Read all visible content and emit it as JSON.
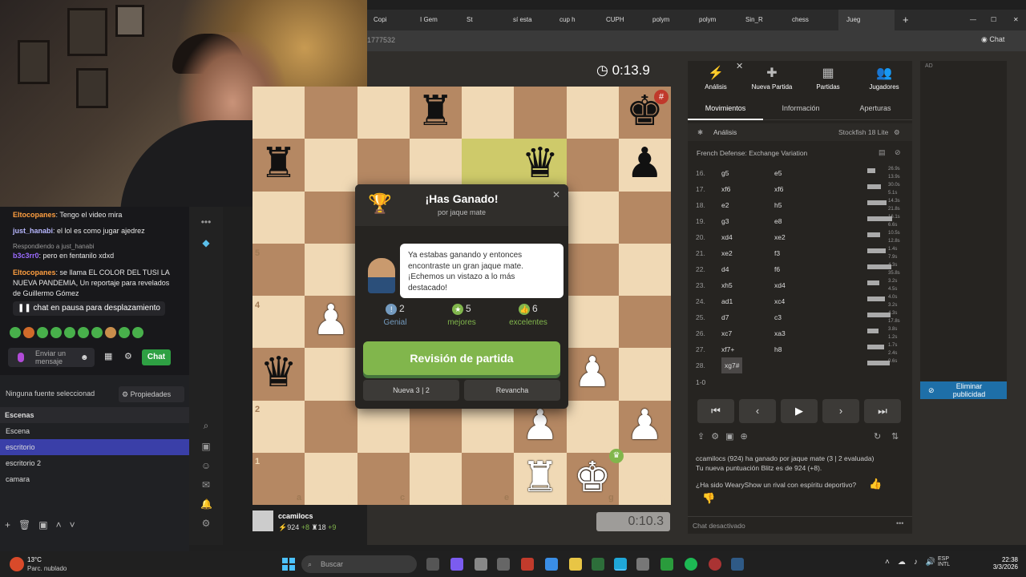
{
  "browser": {
    "tabs": [
      "Copi",
      "I Gem",
      "St",
      "sí esta",
      "cup h",
      "CUPH",
      "polym",
      "polym",
      "Sin_R",
      "chess",
      "Jueg"
    ],
    "url": "1777532"
  },
  "game": {
    "top_clock": "0:13.9",
    "bottom_clock": "0:10.3",
    "ranks": [
      "5",
      "4",
      "3",
      "2",
      "1"
    ],
    "files": [
      "a",
      "b",
      "c",
      "d",
      "e",
      "f",
      "g",
      "h"
    ],
    "player": {
      "name": "ccamilocs",
      "rating": "924",
      "rating_delta": "+8",
      "puzzles": "18",
      "puzzles_delta": "+9"
    }
  },
  "modal": {
    "title": "¡Has Ganado!",
    "subtitle": "por jaque mate",
    "message": "Ya estabas ganando y entonces encontraste un gran jaque mate. ¡Echemos un vistazo a lo más destacado!",
    "stats": [
      {
        "count": "2",
        "label": "Genial",
        "color": "#749bbf"
      },
      {
        "count": "5",
        "label": "mejores",
        "color": "#81b64c"
      },
      {
        "count": "6",
        "label": "excelentes",
        "color": "#81b64c"
      }
    ],
    "review_button": "Revisión de partida",
    "new_game_button": "Nueva 3 | 2",
    "rematch_button": "Revancha"
  },
  "panel": {
    "top_tabs": [
      "Análisis",
      "Nueva Partida",
      "Partidas",
      "Jugadores"
    ],
    "sub_tabs": [
      "Movimientos",
      "Información",
      "Aperturas"
    ],
    "analysis_label": "Análisis",
    "engine": "Stockfish 18 Lite",
    "opening": "French Defense: Exchange Variation",
    "moves": [
      {
        "n": "16.",
        "w": "g5",
        "b": "e5",
        "e1": "26.9s",
        "e2": "13.9s"
      },
      {
        "n": "17.",
        "w": "xf6",
        "b": "xf6",
        "e1": "30.0s",
        "e2": "5.1s"
      },
      {
        "n": "18.",
        "w": "e2",
        "b": "h5",
        "e1": "14.3s",
        "e2": "21.8s"
      },
      {
        "n": "19.",
        "w": "g3",
        "b": "e8",
        "e1": "16.1s",
        "e2": "6.6s"
      },
      {
        "n": "20.",
        "w": "xd4",
        "b": "xe2",
        "e1": "10.5s",
        "e2": "12.8s"
      },
      {
        "n": "21.",
        "w": "xe2",
        "b": "f3",
        "e1": "1.4s",
        "e2": "7.9s"
      },
      {
        "n": "22.",
        "w": "d4",
        "b": "f6",
        "e1": "4.3s",
        "e2": "35.8s"
      },
      {
        "n": "23.",
        "w": "xh5",
        "b": "xd4",
        "e1": "3.2s",
        "e2": "4.5s"
      },
      {
        "n": "24.",
        "w": "ad1",
        "b": "xc4",
        "e1": "4.0s",
        "e2": "3.2s"
      },
      {
        "n": "25.",
        "w": "d7",
        "b": "c3",
        "e1": "4.3s",
        "e2": "17.8s"
      },
      {
        "n": "26.",
        "w": "xc7",
        "b": "xa3",
        "e1": "3.8s",
        "e2": "1.2s"
      },
      {
        "n": "27.",
        "w": "xf7+",
        "b": "h8",
        "e1": "1.7s",
        "e2": "2.4s"
      },
      {
        "n": "28.",
        "w": "xg7#",
        "b": "",
        "e1": "0.6s",
        "e2": ""
      }
    ],
    "result": "1-0",
    "summary_line1": "ccamilocs (924) ha ganado por jaque mate (3 | 2 evaluada)",
    "summary_line2": "Tu nueva puntuación Blitz es de 924 (+8).",
    "sportsmanship": "¿Ha sido WearyShow un rival con espíritu deportivo?",
    "chat_status": "Chat desactivado"
  },
  "ad": {
    "label": "AD",
    "remove_button": "Eliminar publicidad"
  },
  "stream_chat": {
    "messages": [
      {
        "user": "Eltocopanes",
        "text": "Tengo el video mira"
      },
      {
        "user": "just_hanabi",
        "text": "el lol es como jugar ajedrez"
      },
      {
        "user": "b3c3rr0",
        "text": "pero en fentanilo xdxd"
      },
      {
        "user": "Eltocopanes",
        "text": "se llama EL COLOR DEL TUSI LA NUEVA PANDEMIA, Un reportaje para revelados de Guillermo Gómez"
      }
    ],
    "replying": "Respondiendo a just_hanabi",
    "paused": "chat en pausa para desplazamiento",
    "input_placeholder": "Enviar un mensaje",
    "chat_button": "Chat"
  },
  "obs": {
    "source_label": "Ninguna fuente seleccionad",
    "props_button": "Propiedades",
    "scenes_header": "Escenas",
    "scenes": [
      "Escena",
      "escritorio",
      "escritorio 2",
      "camara"
    ]
  },
  "taskbar": {
    "weather_temp": "13°C",
    "weather_desc": "Parc. nublado",
    "search_placeholder": "Buscar",
    "lang1": "ESP",
    "lang2": "INTL",
    "time": "22:38",
    "date": "3/3/2026"
  }
}
